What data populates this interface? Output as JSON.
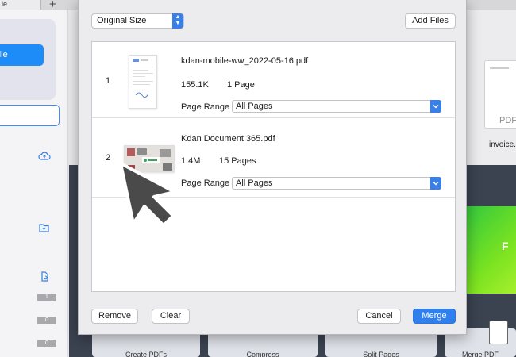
{
  "background": {
    "tab_label": "le",
    "sidebar": {
      "open_file_label": "File",
      "badges": [
        "1",
        "0",
        "0"
      ]
    },
    "recent": {
      "file_type": "PDF",
      "file_name": "invoice."
    },
    "tools": [
      "Create PDFs",
      "Compress",
      "Split Pages",
      "Merge PDF"
    ],
    "banner_text": "F"
  },
  "dialog": {
    "size_select": {
      "value": "Original Size"
    },
    "add_files_label": "Add Files",
    "files": [
      {
        "index": "1",
        "name": "kdan-mobile-ww_2022-05-16.pdf",
        "size": "155.1K",
        "pages": "1 Page",
        "range_label": "Page Range",
        "range_value": "All Pages"
      },
      {
        "index": "2",
        "name": "Kdan Document 365.pdf",
        "size": "1.4M",
        "pages": "15 Pages",
        "range_label": "Page Range",
        "range_value": "All Pages"
      }
    ],
    "remove_label": "Remove",
    "clear_label": "Clear",
    "cancel_label": "Cancel",
    "merge_label": "Merge"
  },
  "colors": {
    "accent": "#2f80ed",
    "dark_background": "#3b4250",
    "banner_green": "#5bd62e"
  }
}
